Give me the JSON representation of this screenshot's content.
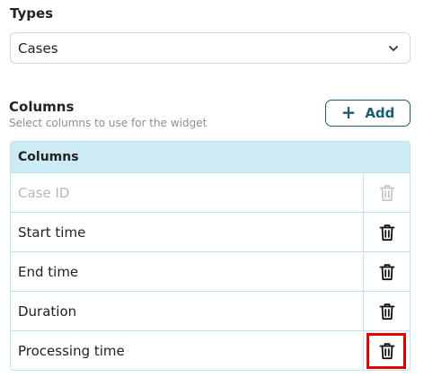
{
  "types": {
    "label": "Types",
    "selected": "Cases"
  },
  "columns": {
    "title": "Columns",
    "subtitle": "Select columns to use for the widget",
    "add_label": "Add",
    "table_header": "Columns",
    "rows": [
      {
        "label": "Case ID",
        "disabled": true
      },
      {
        "label": "Start time",
        "disabled": false
      },
      {
        "label": "End time",
        "disabled": false
      },
      {
        "label": "Duration",
        "disabled": false
      },
      {
        "label": "Processing time",
        "disabled": false,
        "highlighted": true
      }
    ]
  },
  "colors": {
    "accent": "#1d5d70",
    "header_bg": "#cdebf5",
    "highlight": "#e00000"
  },
  "icons": {
    "dropdown": "chevron-down-icon",
    "add": "plus-icon",
    "delete": "trash-icon"
  }
}
